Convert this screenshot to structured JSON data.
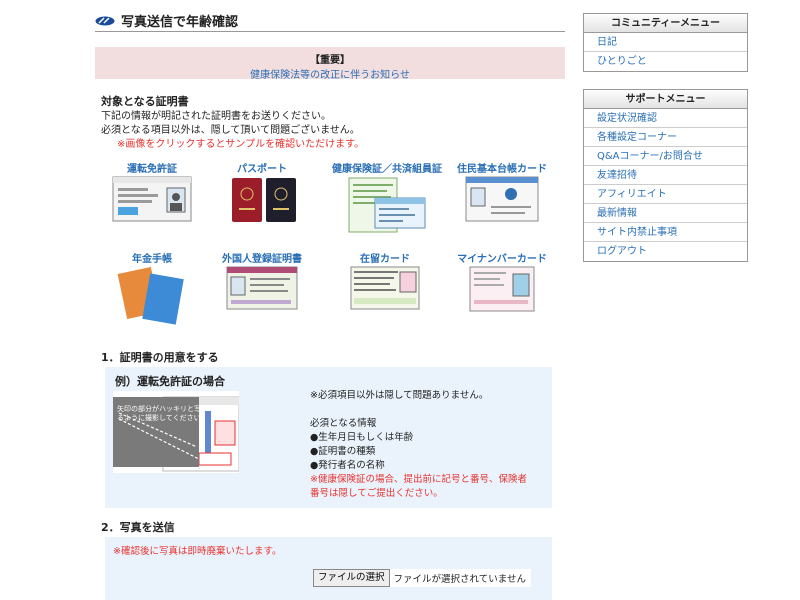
{
  "page": {
    "title": "写真送信で年齢確認",
    "notice": {
      "heading": "【重要】",
      "link": "健康保険法等の改正に伴うお知らせ"
    },
    "section_title": "対象となる証明書",
    "intro": [
      "下記の情報が明記された証明書をお送りください。",
      "必須となる項目以外は、隠して頂いて問題ございません。"
    ],
    "intro_note": "※画像をクリックするとサンプルを確認いただけます。",
    "cards": [
      {
        "label": "運転免許証",
        "icon": "drivers-license-image"
      },
      {
        "label": "パスポート",
        "icon": "passport-image"
      },
      {
        "label": "健康保険証／共済組員証",
        "icon": "health-insurance-card-image"
      },
      {
        "label": "住民基本台帳カード",
        "icon": "resident-registry-card-image"
      },
      {
        "label": "年金手帳",
        "icon": "pension-book-image"
      },
      {
        "label": "外国人登録証明書",
        "icon": "alien-registration-image"
      },
      {
        "label": "在留カード",
        "icon": "residence-card-image"
      },
      {
        "label": "マイナンバーカード",
        "icon": "mynumber-card-image"
      }
    ]
  },
  "step1": {
    "title": "1．証明書の用意をする",
    "example_title": "例）運転免許証の場合",
    "photo_caption": "矢印の部分がハッキリと写るように撮影してください",
    "note": "※必須項目以外は隠して問題ありません。",
    "required_heading": "必須となる情報",
    "required": [
      "●生年月日もしくは年齢",
      "●証明書の種類",
      "●発行者名の名称"
    ],
    "warning": [
      "※健康保険証の場合、提出前に記号と番号、保険者",
      "番号は隠してご提出ください。"
    ]
  },
  "step2": {
    "title": "2．写真を送信",
    "note": "※確認後に写真は即時廃棄いたします。",
    "file_button": "ファイルの選択",
    "file_status": "ファイルが選択されていません"
  },
  "sidebar": {
    "community": {
      "heading": "コミュニティーメニュー",
      "items": [
        "日記",
        "ひとりごと"
      ]
    },
    "support": {
      "heading": "サポートメニュー",
      "items": [
        "設定状況確認",
        "各種設定コーナー",
        "Q&Aコーナー/お問合せ",
        "友達招待",
        "アフィリエイト",
        "最新情報",
        "サイト内禁止事項",
        "ログアウト"
      ]
    }
  },
  "colors": {
    "link": "#2a6fb5",
    "red": "#e8312f",
    "notice_bg": "#f2dede",
    "box_bg": "#eaf3fc"
  }
}
